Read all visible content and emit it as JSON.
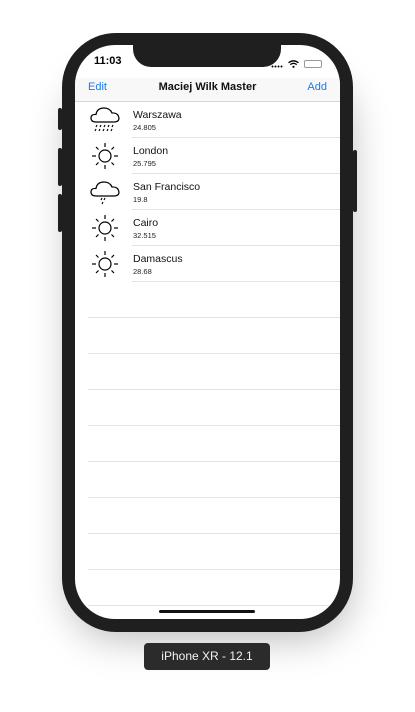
{
  "status_bar": {
    "time": "11:03"
  },
  "nav": {
    "left": "Edit",
    "title": "Maciej Wilk Master",
    "right": "Add"
  },
  "rows": [
    {
      "city": "Warszawa",
      "temp": "24.805",
      "icon": "heavy-rain-icon"
    },
    {
      "city": "London",
      "temp": "25.795",
      "icon": "sun-icon"
    },
    {
      "city": "San Francisco",
      "temp": "19.8",
      "icon": "light-rain-icon"
    },
    {
      "city": "Cairo",
      "temp": "32.515",
      "icon": "sun-icon"
    },
    {
      "city": "Damascus",
      "temp": "28.68",
      "icon": "sun-icon"
    }
  ],
  "device_label": "iPhone XR - 12.1",
  "colors": {
    "accent": "#1a7ce6",
    "bezel": "#1f1f1f"
  }
}
